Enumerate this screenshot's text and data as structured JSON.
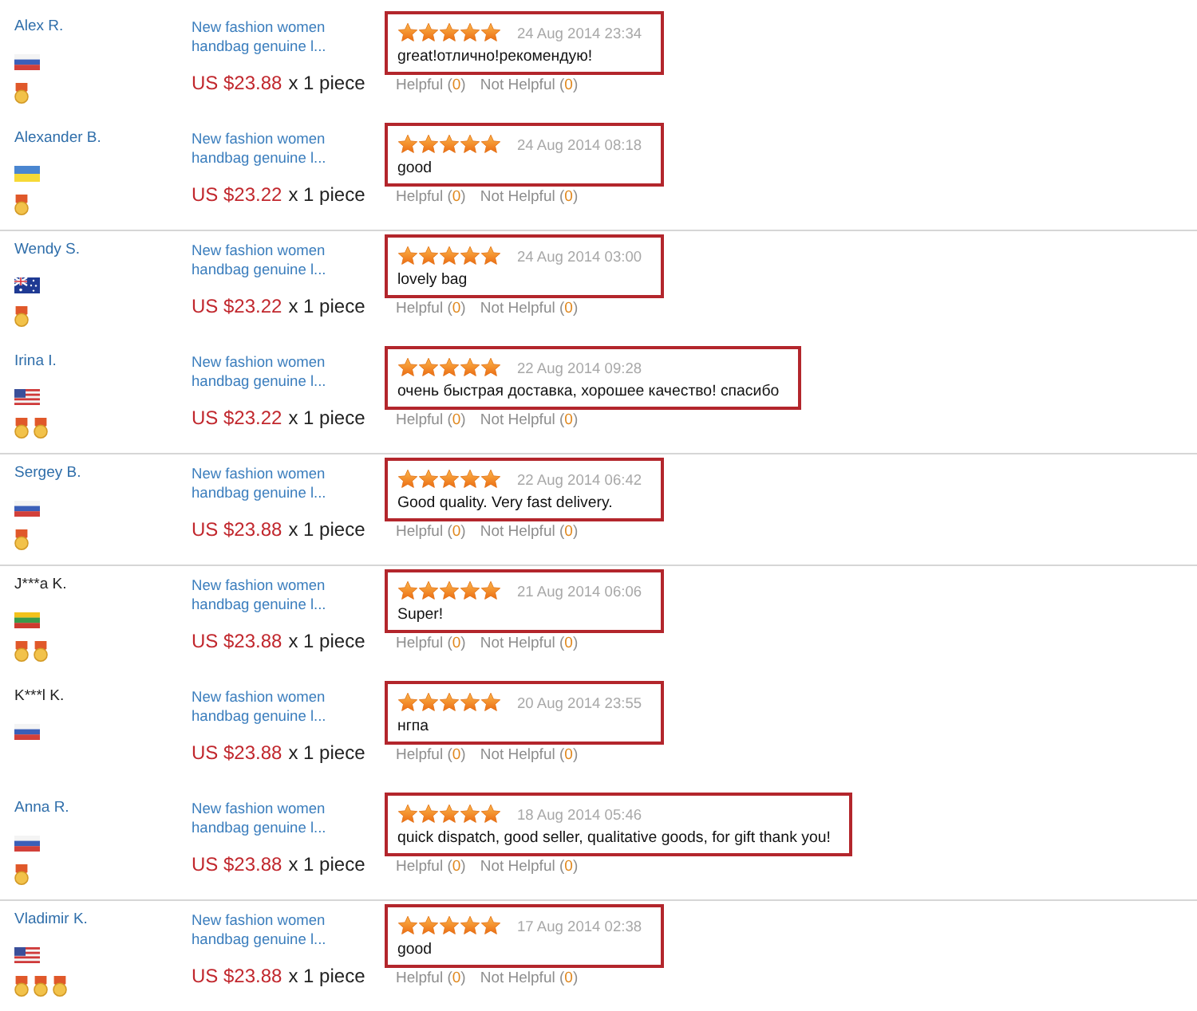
{
  "reviews": [
    {
      "buyer": {
        "name": "Alex R.",
        "linked": true,
        "flag": {
          "kind": "ru"
        },
        "badges": [
          {
            "kind": "medal"
          }
        ]
      },
      "product": {
        "title": "New fashion women handbag genuine l...",
        "price": "US $23.88",
        "quantity": "x 1 piece"
      },
      "stars": 5,
      "date": "24 Aug 2014 23:34",
      "text": "great!отлично!рекомендую!",
      "helpful": {
        "label": "Helpful (",
        "count": "0",
        "close": ")"
      },
      "not_helpful": {
        "label": "Not Helpful (",
        "count": "0",
        "close": ")"
      },
      "divider_below": false
    },
    {
      "buyer": {
        "name": "Alexander B.",
        "linked": true,
        "flag": {
          "kind": "ua"
        },
        "badges": [
          {
            "kind": "medal"
          }
        ]
      },
      "product": {
        "title": "New fashion women handbag genuine l...",
        "price": "US $23.22",
        "quantity": "x 1 piece"
      },
      "stars": 5,
      "date": "24 Aug 2014 08:18",
      "text": "good",
      "helpful": {
        "label": "Helpful (",
        "count": "0",
        "close": ")"
      },
      "not_helpful": {
        "label": "Not Helpful (",
        "count": "0",
        "close": ")"
      },
      "divider_below": true
    },
    {
      "buyer": {
        "name": "Wendy S.",
        "linked": true,
        "flag": {
          "kind": "au"
        },
        "badges": [
          {
            "kind": "medal"
          }
        ]
      },
      "product": {
        "title": "New fashion women handbag genuine l...",
        "price": "US $23.22",
        "quantity": "x 1 piece"
      },
      "stars": 5,
      "date": "24 Aug 2014 03:00",
      "text": "lovely bag",
      "helpful": {
        "label": "Helpful (",
        "count": "0",
        "close": ")"
      },
      "not_helpful": {
        "label": "Not Helpful (",
        "count": "0",
        "close": ")"
      },
      "divider_below": false
    },
    {
      "buyer": {
        "name": "Irina I.",
        "linked": true,
        "flag": {
          "kind": "us"
        },
        "badges": [
          {
            "kind": "medal"
          },
          {
            "kind": "medal"
          }
        ]
      },
      "product": {
        "title": "New fashion women handbag genuine l...",
        "price": "US $23.22",
        "quantity": "x 1 piece"
      },
      "stars": 5,
      "date": "22 Aug 2014 09:28",
      "text": "очень быстрая доставка, хорошее качество! спасибо",
      "helpful": {
        "label": "Helpful (",
        "count": "0",
        "close": ")"
      },
      "not_helpful": {
        "label": "Not Helpful (",
        "count": "0",
        "close": ")"
      },
      "divider_below": true
    },
    {
      "buyer": {
        "name": "Sergey B.",
        "linked": true,
        "flag": {
          "kind": "ru"
        },
        "badges": [
          {
            "kind": "medal"
          }
        ]
      },
      "product": {
        "title": "New fashion women handbag genuine l...",
        "price": "US $23.88",
        "quantity": "x 1 piece"
      },
      "stars": 5,
      "date": "22 Aug 2014 06:42",
      "text": "Good quality. Very fast delivery.",
      "helpful": {
        "label": "Helpful (",
        "count": "0",
        "close": ")"
      },
      "not_helpful": {
        "label": "Not Helpful (",
        "count": "0",
        "close": ")"
      },
      "divider_below": true
    },
    {
      "buyer": {
        "name": "J***a K.",
        "linked": false,
        "flag": {
          "kind": "lt"
        },
        "badges": [
          {
            "kind": "medal"
          },
          {
            "kind": "medal"
          }
        ]
      },
      "product": {
        "title": "New fashion women handbag genuine l...",
        "price": "US $23.88",
        "quantity": "x 1 piece"
      },
      "stars": 5,
      "date": "21 Aug 2014 06:06",
      "text": "Super!",
      "helpful": {
        "label": "Helpful (",
        "count": "0",
        "close": ")"
      },
      "not_helpful": {
        "label": "Not Helpful (",
        "count": "0",
        "close": ")"
      },
      "divider_below": false
    },
    {
      "buyer": {
        "name": "K***l K.",
        "linked": false,
        "flag": {
          "kind": "ru"
        }
      },
      "product": {
        "title": "New fashion women handbag genuine l...",
        "price": "US $23.88",
        "quantity": "x 1 piece"
      },
      "stars": 5,
      "date": "20 Aug 2014 23:55",
      "text": "нгпа",
      "helpful": {
        "label": "Helpful (",
        "count": "0",
        "close": ")"
      },
      "not_helpful": {
        "label": "Not Helpful (",
        "count": "0",
        "close": ")"
      },
      "divider_below": false
    },
    {
      "buyer": {
        "name": "Anna R.",
        "linked": true,
        "flag": {
          "kind": "ru"
        },
        "badges": [
          {
            "kind": "medal"
          }
        ]
      },
      "product": {
        "title": "New fashion women handbag genuine l...",
        "price": "US $23.88",
        "quantity": "x 1 piece"
      },
      "stars": 5,
      "date": "18 Aug 2014 05:46",
      "text": "quick dispatch, good seller, qualitative goods, for gift thank you!",
      "helpful": {
        "label": "Helpful (",
        "count": "0",
        "close": ")"
      },
      "not_helpful": {
        "label": "Not Helpful (",
        "count": "0",
        "close": ")"
      },
      "divider_below": true
    },
    {
      "buyer": {
        "name": "Vladimir K.",
        "linked": true,
        "flag": {
          "kind": "us"
        },
        "badges": [
          {
            "kind": "medal"
          },
          {
            "kind": "medal"
          },
          {
            "kind": "medal"
          }
        ]
      },
      "product": {
        "title": "New fashion women handbag genuine l...",
        "price": "US $23.88",
        "quantity": "x 1 piece"
      },
      "stars": 5,
      "date": "17 Aug 2014 02:38",
      "text": "good",
      "helpful": {
        "label": "Helpful (",
        "count": "0",
        "close": ")"
      },
      "not_helpful": {
        "label": "Not Helpful (",
        "count": "0",
        "close": ")"
      },
      "divider_below": false
    }
  ]
}
